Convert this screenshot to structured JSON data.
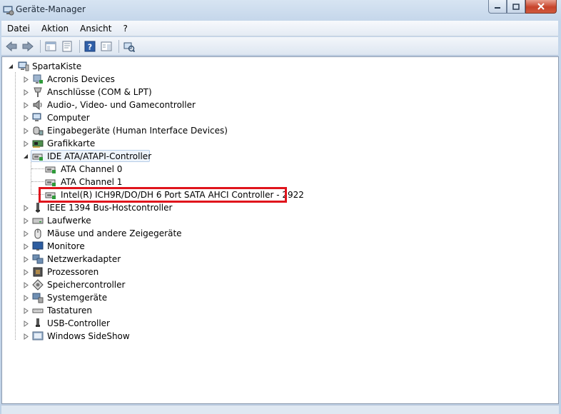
{
  "window": {
    "title": "Geräte-Manager"
  },
  "menu": [
    "Datei",
    "Aktion",
    "Ansicht",
    "?"
  ],
  "toolbar": {
    "buttons": [
      "back-icon",
      "forward-icon",
      "properties-icon",
      "update-icon",
      "help-icon",
      "view-icon",
      "scan-hardware-icon"
    ]
  },
  "tree": {
    "root": "SpartaKiste",
    "categories": [
      "Acronis Devices",
      "Anschlüsse (COM & LPT)",
      "Audio-, Video- und Gamecontroller",
      "Computer",
      "Eingabegeräte (Human Interface Devices)",
      "Grafikkarte",
      "IDE ATA/ATAPI-Controller",
      "IEEE 1394 Bus-Hostcontroller",
      "Laufwerke",
      "Mäuse und andere Zeigegeräte",
      "Monitore",
      "Netzwerkadapter",
      "Prozessoren",
      "Speichercontroller",
      "Systemgeräte",
      "Tastaturen",
      "USB-Controller",
      "Windows SideShow"
    ],
    "ide_children": [
      "ATA Channel 0",
      "ATA Channel 1",
      "Intel(R) ICH9R/DO/DH 6 Port SATA AHCI Controller - 2922"
    ]
  },
  "colors": {
    "highlight_box": "#e0141c",
    "selection": "#eef4fb"
  }
}
